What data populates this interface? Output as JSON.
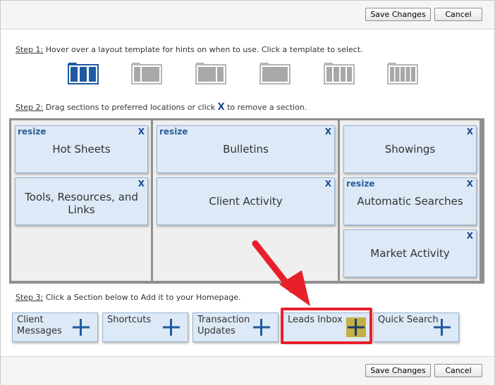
{
  "buttons": {
    "save_label": "Save Changes",
    "cancel_label": "Cancel"
  },
  "step1": {
    "label": "Step 1:",
    "text": " Hover over a layout template for hints on when to use. Click a template to select.",
    "templates": [
      "template-3col-selected",
      "template-2col-wide-right",
      "template-2col-wide-left",
      "template-1col",
      "template-4col",
      "template-5col"
    ]
  },
  "step2": {
    "label": "Step 2:",
    "text_before": " Drag sections to preferred locations or click ",
    "x_symbol": "X",
    "text_after": " to remove a section.",
    "columns": [
      {
        "cards": [
          {
            "title": "Hot Sheets",
            "resize": "resize",
            "close": "X"
          },
          {
            "title": "Tools, Resources, and Links",
            "close": "X"
          }
        ]
      },
      {
        "cards": [
          {
            "title": "Bulletins",
            "resize": "resize",
            "close": "X"
          },
          {
            "title": "Client Activity",
            "close": "X"
          }
        ]
      },
      {
        "cards": [
          {
            "title": "Showings",
            "close": "X"
          },
          {
            "title": "Automatic Searches",
            "resize": "resize",
            "close": "X"
          },
          {
            "title": "Market Activity",
            "close": "X"
          }
        ]
      }
    ]
  },
  "step3": {
    "label": "Step 3:",
    "text": " Click a Section below to Add it to your Homepage.",
    "sections": [
      {
        "line1": "Client",
        "line2": "Messages"
      },
      {
        "line1": "Shortcuts",
        "line2": ""
      },
      {
        "line1": "Transaction",
        "line2": "Updates"
      },
      {
        "line1": "Leads Inbox",
        "line2": ""
      },
      {
        "line1": "Quick Search",
        "line2": ""
      }
    ]
  },
  "colors": {
    "card_bg": "#dde9f6",
    "accent": "#1a4a8e",
    "highlight": "#e8202a",
    "plus_highlight": "#c5b046"
  }
}
